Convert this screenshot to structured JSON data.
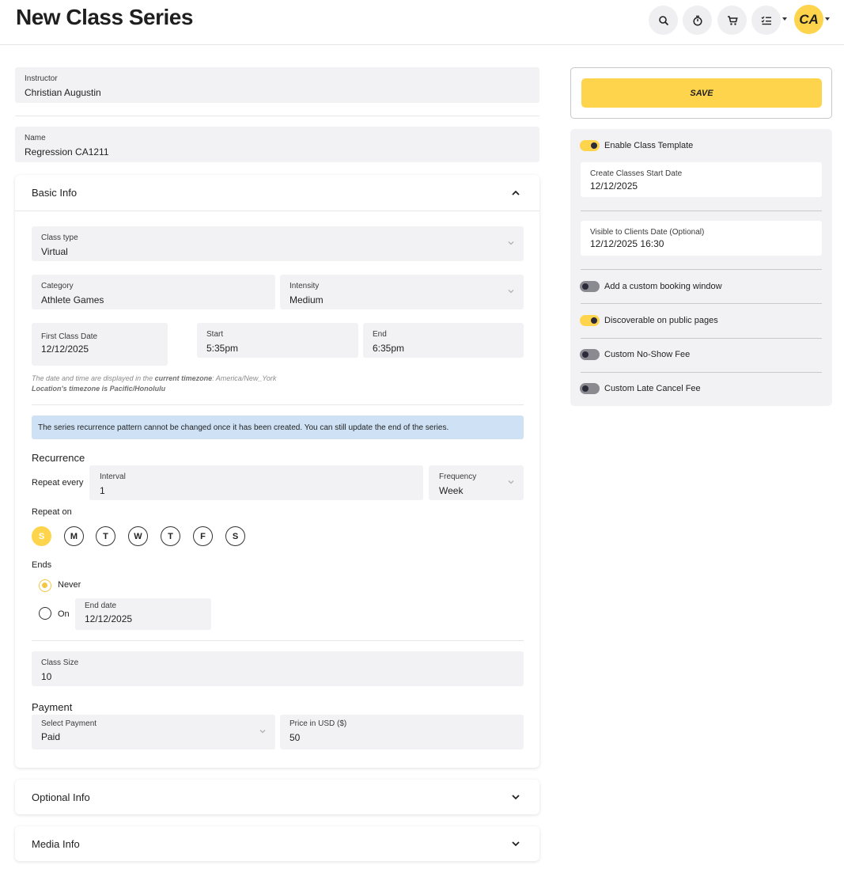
{
  "header": {
    "title": "New Class Series",
    "avatar_initials": "CA",
    "icons": [
      "search-icon",
      "stopwatch-icon",
      "cart-icon",
      "checklist-icon"
    ]
  },
  "instructor": {
    "label": "Instructor",
    "value": "Christian Augustin"
  },
  "name": {
    "label": "Name",
    "value": "Regression CA1211"
  },
  "basic_info": {
    "title": "Basic Info",
    "class_type": {
      "label": "Class type",
      "value": "Virtual"
    },
    "category": {
      "label": "Category",
      "value": "Athlete Games"
    },
    "intensity": {
      "label": "Intensity",
      "value": "Medium"
    },
    "first_class_date": {
      "label": "First Class Date",
      "value": "12/12/2025"
    },
    "start": {
      "label": "Start",
      "value": "5:35pm"
    },
    "end": {
      "label": "End",
      "value": "6:35pm"
    },
    "tz_note_prefix": "The date and time are displayed in the",
    "tz_note_bold": "current timezone",
    "tz_note_suffix": ": America/New_York",
    "location_tz": "Location's timezone is Pacific/Honolulu",
    "banner": "The series recurrence pattern cannot be changed once it has been created. You can still update the end of the series.",
    "recurrence_label": "Recurrence",
    "repeat_every_label": "Repeat every",
    "interval": {
      "label": "Interval",
      "value": "1"
    },
    "frequency": {
      "label": "Frequency",
      "value": "Week"
    },
    "repeat_on_label": "Repeat on",
    "days": [
      "S",
      "M",
      "T",
      "W",
      "T",
      "F",
      "S"
    ],
    "ends_label": "Ends",
    "ends_never": "Never",
    "ends_on": "On",
    "end_date": {
      "label": "End date",
      "value": "12/12/2025"
    },
    "class_size": {
      "label": "Class Size",
      "value": "10"
    },
    "payment_label": "Payment",
    "select_payment": {
      "label": "Select Payment",
      "value": "Paid"
    },
    "price": {
      "label": "Price in USD ($)",
      "value": "50"
    }
  },
  "optional_info": {
    "title": "Optional Info"
  },
  "media_info": {
    "title": "Media Info"
  },
  "right": {
    "save_label": "SAVE",
    "enable_template": "Enable Class Template",
    "create_start": {
      "label": "Create Classes Start Date",
      "value": "12/12/2025"
    },
    "visible_date": {
      "label": "Visible to Clients Date (Optional)",
      "value": "12/12/2025 16:30"
    },
    "booking_window": "Add a custom booking window",
    "discoverable": "Discoverable on public pages",
    "no_show": "Custom No-Show Fee",
    "late_cancel": "Custom Late Cancel Fee"
  },
  "colors": {
    "accent": "#ffd44d",
    "banner": "#cfe2f5",
    "field": "#f2f2f4"
  }
}
